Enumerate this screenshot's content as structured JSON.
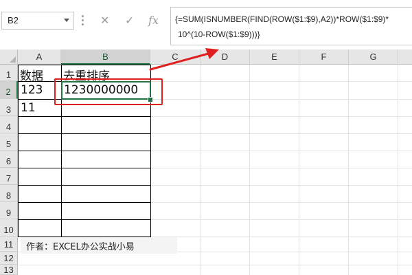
{
  "formula_bar": {
    "name_box": "B2",
    "cancel_icon": "✕",
    "enter_icon": "✓",
    "fx_label": "fx",
    "formula_line1": "{=SUM(ISNUMBER(FIND(ROW($1:$9),A2))*ROW($1:$9)*",
    "formula_line2": "10^(10-ROW($1:$9)))}"
  },
  "sheet": {
    "columns": [
      "A",
      "B",
      "C",
      "D",
      "E",
      "F",
      "G"
    ],
    "rows": [
      "1",
      "2",
      "3",
      "4",
      "5",
      "6",
      "7",
      "8",
      "9",
      "10",
      "11",
      "12",
      "13"
    ],
    "cells": {
      "A1": "数据",
      "B1": "去重排序",
      "A2": "123",
      "B2": "1230000000",
      "A3": "11"
    },
    "footer_note": "作者：EXCEL办公实战小易"
  },
  "colors": {
    "accent_green": "#217346",
    "highlight_red": "#e02020"
  }
}
